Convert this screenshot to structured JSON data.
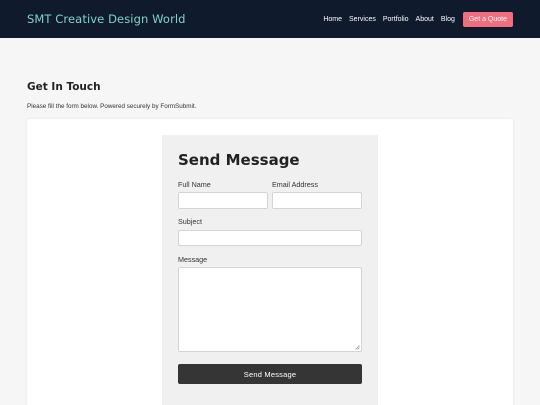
{
  "navbar": {
    "brand": "SMT Creative Design World",
    "links": [
      "Home",
      "Services",
      "Portfolio",
      "About",
      "Blog"
    ],
    "cta_label": "Get a Quote",
    "background_color": "#0f1b2d",
    "brand_color": "#7fd3c7",
    "cta_color": "#f26d7d"
  },
  "contact": {
    "title": "Get In Touch",
    "description": "Please fill the form below. Powered securely by FormSubmit."
  },
  "form": {
    "title": "Send Message",
    "full_name_label": "Full Name",
    "full_name_value": "",
    "email_label": "Email Address",
    "email_value": "",
    "subject_label": "Subject",
    "subject_value": "",
    "message_label": "Message",
    "message_value": "",
    "submit_label": "Send Message",
    "submit_color": "#353535"
  }
}
